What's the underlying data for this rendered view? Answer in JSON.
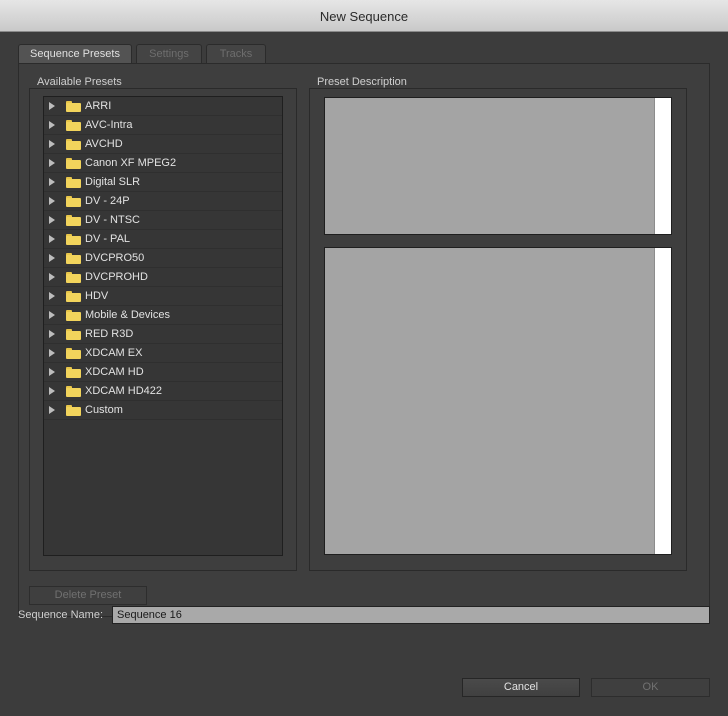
{
  "window": {
    "title": "New Sequence"
  },
  "tabs": [
    {
      "label": "Sequence Presets",
      "active": true
    },
    {
      "label": "Settings",
      "active": false
    },
    {
      "label": "Tracks",
      "active": false
    }
  ],
  "presets": {
    "group_label": "Available Presets",
    "items": [
      {
        "label": "ARRI"
      },
      {
        "label": "AVC-Intra"
      },
      {
        "label": "AVCHD"
      },
      {
        "label": "Canon XF MPEG2"
      },
      {
        "label": "Digital SLR"
      },
      {
        "label": "DV - 24P"
      },
      {
        "label": "DV - NTSC"
      },
      {
        "label": "DV - PAL"
      },
      {
        "label": "DVCPRO50"
      },
      {
        "label": "DVCPROHD"
      },
      {
        "label": "HDV"
      },
      {
        "label": "Mobile & Devices"
      },
      {
        "label": "RED R3D"
      },
      {
        "label": "XDCAM EX"
      },
      {
        "label": "XDCAM HD"
      },
      {
        "label": "XDCAM HD422"
      },
      {
        "label": "Custom"
      }
    ],
    "delete_label": "Delete Preset"
  },
  "description": {
    "group_label": "Preset Description"
  },
  "sequence_name": {
    "label": "Sequence Name:",
    "value": "Sequence 16"
  },
  "footer": {
    "cancel_label": "Cancel",
    "ok_label": "OK"
  },
  "colors": {
    "folder": "#f2d45c",
    "background": "#3c3c3c"
  }
}
